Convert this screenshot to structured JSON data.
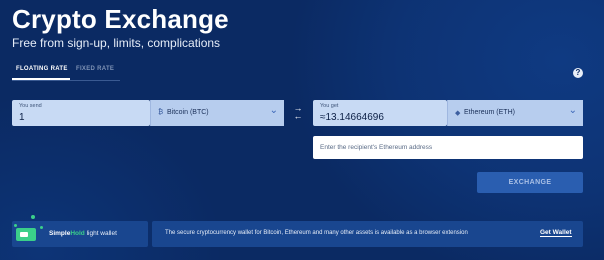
{
  "header": {
    "title": "Crypto Exchange",
    "subtitle": "Free from sign-up, limits, complications"
  },
  "tabs": [
    {
      "label": "FLOATING RATE",
      "active": true
    },
    {
      "label": "FIXED RATE",
      "active": false
    }
  ],
  "help_label": "?",
  "send": {
    "label": "You send",
    "value": "1",
    "currency": "Bitcoin (BTC)",
    "currency_icon": "bitcoin-icon",
    "currency_glyph": "₿"
  },
  "swap_glyph": "⇄",
  "get": {
    "label": "You get",
    "value": "≈13.14664696",
    "currency": "Ethereum (ETH)",
    "currency_icon": "ethereum-icon",
    "currency_glyph": "◆"
  },
  "address": {
    "placeholder": "Enter the recipient's Ethereum address"
  },
  "exchange_button": "EXCHANGE",
  "banner": {
    "brand_part1": "Simple",
    "brand_part2": "Hold",
    "brand_part3": " light wallet",
    "text": "The secure cryptocurrency wallet for Bitcoin, Ethereum and many other assets is available as a browser extension",
    "link": "Get Wallet"
  },
  "colors": {
    "background": "#0b2a63",
    "field": "#c8daf4",
    "button": "#2a5eb0",
    "accent_green": "#3bcf8a"
  }
}
